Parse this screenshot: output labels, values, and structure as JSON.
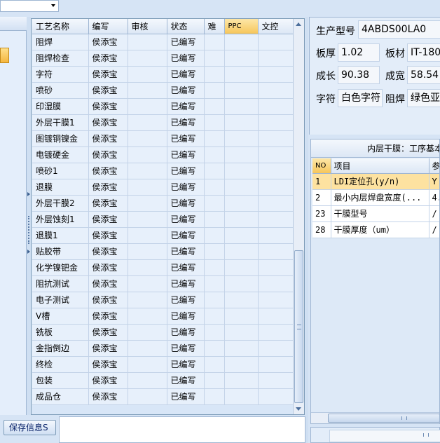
{
  "process_grid": {
    "columns": [
      "工艺名称",
      "编写",
      "审核",
      "状态",
      "难",
      "PPC",
      "文控"
    ],
    "rows": [
      [
        "阻焊",
        "侯添宝",
        "",
        "已编写",
        "",
        "",
        ""
      ],
      [
        "阻焊检查",
        "侯添宝",
        "",
        "已编写",
        "",
        "",
        ""
      ],
      [
        "字符",
        "侯添宝",
        "",
        "已编写",
        "",
        "",
        ""
      ],
      [
        "喷砂",
        "侯添宝",
        "",
        "已编写",
        "",
        "",
        ""
      ],
      [
        "印湿膜",
        "侯添宝",
        "",
        "已编写",
        "",
        "",
        ""
      ],
      [
        "外层干膜1",
        "侯添宝",
        "",
        "已编写",
        "",
        "",
        ""
      ],
      [
        "图镀铜镍金",
        "侯添宝",
        "",
        "已编写",
        "",
        "",
        ""
      ],
      [
        "电镀硬金",
        "侯添宝",
        "",
        "已编写",
        "",
        "",
        ""
      ],
      [
        "喷砂1",
        "侯添宝",
        "",
        "已编写",
        "",
        "",
        ""
      ],
      [
        "退膜",
        "侯添宝",
        "",
        "已编写",
        "",
        "",
        ""
      ],
      [
        "外层干膜2",
        "侯添宝",
        "",
        "已编写",
        "",
        "",
        ""
      ],
      [
        "外层蚀刻1",
        "侯添宝",
        "",
        "已编写",
        "",
        "",
        ""
      ],
      [
        "退膜1",
        "侯添宝",
        "",
        "已编写",
        "",
        "",
        ""
      ],
      [
        "贴胶带",
        "侯添宝",
        "",
        "已编写",
        "",
        "",
        ""
      ],
      [
        "化学镍钯金",
        "侯添宝",
        "",
        "已编写",
        "",
        "",
        ""
      ],
      [
        "阻抗测试",
        "侯添宝",
        "",
        "已编写",
        "",
        "",
        ""
      ],
      [
        "电子测试",
        "侯添宝",
        "",
        "已编写",
        "",
        "",
        ""
      ],
      [
        "V槽",
        "侯添宝",
        "",
        "已编写",
        "",
        "",
        ""
      ],
      [
        "铣板",
        "侯添宝",
        "",
        "已编写",
        "",
        "",
        ""
      ],
      [
        "金指倒边",
        "侯添宝",
        "",
        "已编写",
        "",
        "",
        ""
      ],
      [
        "终检",
        "侯添宝",
        "",
        "已编写",
        "",
        "",
        ""
      ],
      [
        "包装",
        "侯添宝",
        "",
        "已编写",
        "",
        "",
        ""
      ],
      [
        "成品仓",
        "侯添宝",
        "",
        "已编写",
        "",
        "",
        ""
      ]
    ]
  },
  "save_button": {
    "label": "保存信息S"
  },
  "info_panel": {
    "model_label": "生产型号",
    "model_value": "4ABDS00LA0",
    "thickness_label": "板厚",
    "thickness_value": "1.02",
    "material_label": "板材",
    "material_value": "IT-180",
    "length_label": "成长",
    "length_value": "90.38",
    "width_label": "成宽",
    "width_value": "58.54",
    "silkscreen_label": "字符",
    "silkscreen_value": "白色字符",
    "soldermask_label": "阻焊",
    "soldermask_value": "绿色亚"
  },
  "param_grid": {
    "title": "内层干膜：工序基本",
    "columns": [
      "NO",
      "项目",
      "参"
    ],
    "rows": [
      [
        "1",
        "LDI定位孔(y/n)",
        "Y"
      ],
      [
        "2",
        "最小内层焊盘宽度(...",
        "4."
      ],
      [
        "23",
        "干膜型号",
        "/"
      ],
      [
        "28",
        "干膜厚度（um）",
        "/"
      ]
    ]
  }
}
